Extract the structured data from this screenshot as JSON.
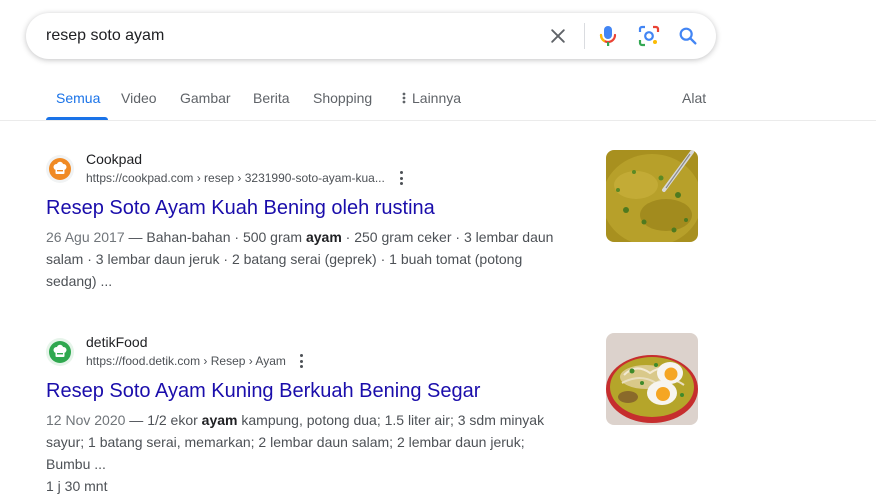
{
  "search": {
    "query": "resep soto ayam"
  },
  "icons": {
    "clear": "close-icon",
    "voice": "microphone-icon",
    "lens": "camera-lens-icon",
    "search": "search-icon",
    "more_vert": "three-dots-vertical-icon"
  },
  "colors": {
    "accent": "#1a73e8",
    "link": "#1a0dab",
    "text": "#202124",
    "muted": "#4d5156"
  },
  "tabs": {
    "items": [
      {
        "label": "Semua",
        "active": true
      },
      {
        "label": "Video"
      },
      {
        "label": "Gambar"
      },
      {
        "label": "Berita"
      },
      {
        "label": "Shopping"
      },
      {
        "label": "Lainnya"
      }
    ],
    "tools": "Alat"
  },
  "results": [
    {
      "site": "Cookpad",
      "url": "https://cookpad.com › resep › 3231990-soto-ayam-kua...",
      "title": "Resep Soto Ayam Kuah Bening oleh rustina",
      "date": "26 Agu 2017",
      "sep": " — ",
      "snippet_a": "Bahan-bahan · 500 gram ",
      "bold": "ayam",
      "snippet_b": " · 250 gram ceker · 3 lembar daun salam · 3 lembar daun jeruk · 2 batang serai (geprek) · 1 buah tomat (potong sedang) ..."
    },
    {
      "site": "detikFood",
      "url": "https://food.detik.com › Resep › Ayam",
      "title": "Resep Soto Ayam Kuning Berkuah Bening Segar",
      "date": "12 Nov 2020",
      "sep": " — ",
      "snippet_a": "1/2 ekor ",
      "bold": "ayam",
      "snippet_b": " kampung, potong dua; 1.5 liter air; 3 sdm minyak sayur; 1 batang serai, memarkan; 2 lembar daun salam; 2 lembar daun jeruk; Bumbu ...",
      "extra": "1 j 30 mnt"
    }
  ]
}
